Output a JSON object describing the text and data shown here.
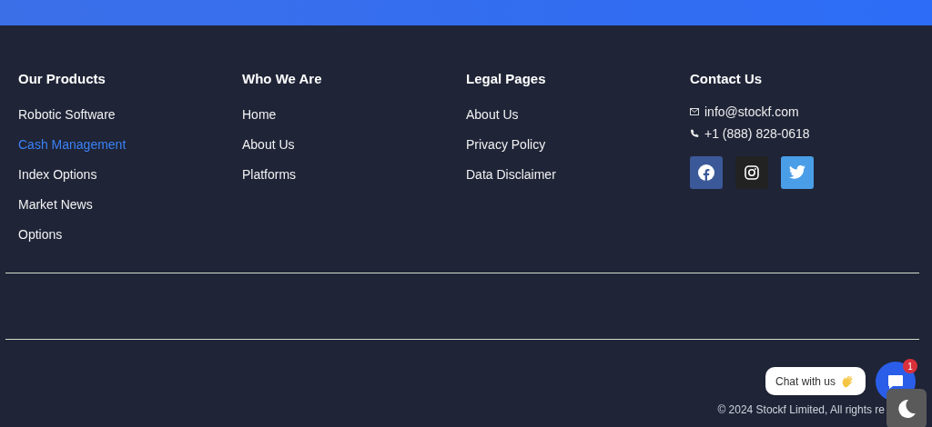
{
  "columns": [
    {
      "heading": "Our Products",
      "links": [
        {
          "label": "Robotic Software",
          "selected": false
        },
        {
          "label": "Cash Management",
          "selected": true
        },
        {
          "label": "Index Options",
          "selected": false
        },
        {
          "label": "Market News",
          "selected": false
        },
        {
          "label": "Options",
          "selected": false
        }
      ]
    },
    {
      "heading": "Who We Are",
      "links": [
        {
          "label": "Home",
          "selected": false
        },
        {
          "label": "About Us",
          "selected": false
        },
        {
          "label": "Platforms",
          "selected": false
        }
      ]
    },
    {
      "heading": "Legal Pages",
      "links": [
        {
          "label": "About Us",
          "selected": false
        },
        {
          "label": "Privacy Policy",
          "selected": false
        },
        {
          "label": "Data Disclaimer",
          "selected": false
        }
      ]
    }
  ],
  "contact": {
    "heading": "Contact Us",
    "email": "info@stockf.com",
    "phone": "+1 (888) 828-0618",
    "social": [
      {
        "kind": "facebook"
      },
      {
        "kind": "instagram"
      },
      {
        "kind": "twitter"
      }
    ]
  },
  "copyright": "© 2024 Stockf Limited, All rights re",
  "chat": {
    "label": "Chat with us",
    "badge": "1"
  }
}
